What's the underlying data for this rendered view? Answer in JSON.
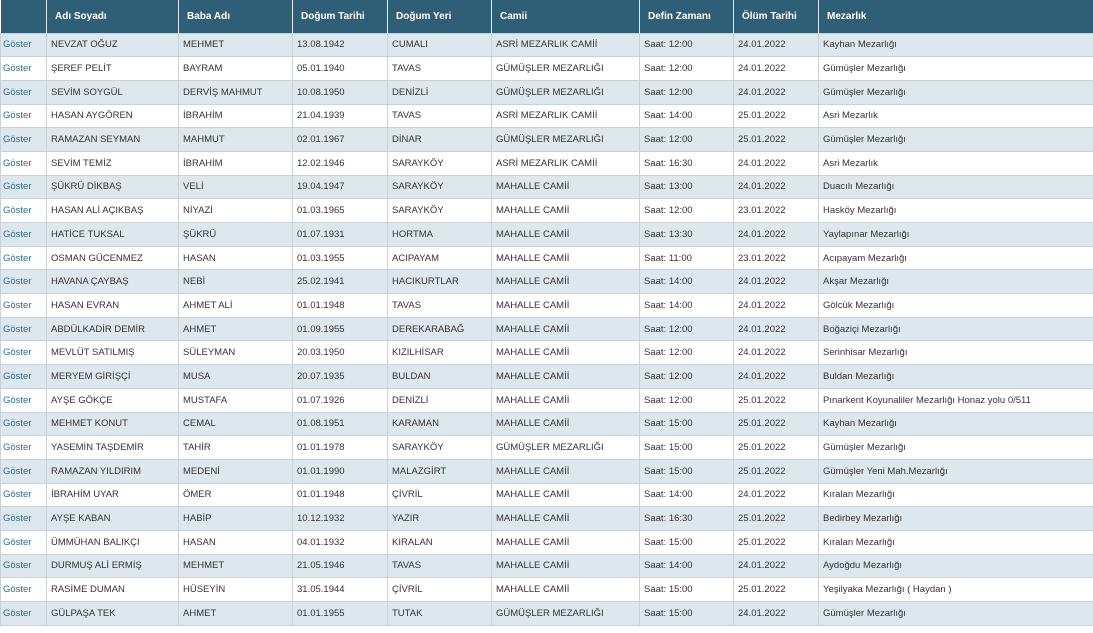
{
  "table": {
    "headers": [
      "",
      "Adı Soyadı",
      "Baba Adı",
      "Doğum Tarihi",
      "Doğum Yeri",
      "Camii",
      "Defin Zamanı",
      "Ölüm Tarihi",
      "Mezarlık"
    ],
    "action_label": "Göster",
    "rows": [
      [
        "NEVZAT OĞUZ",
        "MEHMET",
        "13.08.1942",
        "CUMALI",
        "ASRİ MEZARLIK CAMİİ",
        "Saat: 12:00",
        "24.01.2022",
        "Kayhan Mezarlığı"
      ],
      [
        "ŞEREF PELİT",
        "BAYRAM",
        "05.01.1940",
        "TAVAS",
        "GÜMÜŞLER MEZARLIĞI",
        "Saat: 12:00",
        "24.01.2022",
        "Gümüşler Mezarlığı"
      ],
      [
        "SEVİM SOYGÜL",
        "DERVİŞ MAHMUT",
        "10.08.1950",
        "DENİZLİ",
        "GÜMÜŞLER MEZARLIĞI",
        "Saat: 12:00",
        "24.01.2022",
        "Gümüşler Mezarlığı"
      ],
      [
        "HASAN AYGÖREN",
        "İBRAHİM",
        "21.04.1939",
        "TAVAS",
        "ASRİ MEZARLIK CAMİİ",
        "Saat: 14:00",
        "25.01.2022",
        "Asri Mezarlık"
      ],
      [
        "RAMAZAN SEYMAN",
        "MAHMUT",
        "02.01.1967",
        "DİNAR",
        "GÜMÜŞLER MEZARLIĞI",
        "Saat: 12:00",
        "25.01.2022",
        "Gümüşler Mezarlığı"
      ],
      [
        "SEVİM TEMİZ",
        "İBRAHİM",
        "12.02.1946",
        "SARAYKÖY",
        "ASRİ MEZARLIK CAMİİ",
        "Saat: 16:30",
        "24.01.2022",
        "Asri Mezarlık"
      ],
      [
        "ŞÜKRÜ DİKBAŞ",
        "VELİ",
        "19.04.1947",
        "SARAYKÖY",
        "MAHALLE CAMİİ",
        "Saat: 13:00",
        "24.01.2022",
        "Duacılı Mezarlığı"
      ],
      [
        "HASAN ALİ AÇIKBAŞ",
        "NİYAZİ",
        "01.03.1965",
        "SARAYKÖY",
        "MAHALLE CAMİİ",
        "Saat: 12:00",
        "23.01.2022",
        "Hasköy Mezarlığı"
      ],
      [
        "HATİCE TUKSAL",
        "ŞÜKRÜ",
        "01.07.1931",
        "HORTMA",
        "MAHALLE CAMİİ",
        "Saat: 13:30",
        "24.01.2022",
        "Yaylapınar Mezarlığı"
      ],
      [
        "OSMAN GÜCENMEZ",
        "HASAN",
        "01.03.1955",
        "ACIPAYAM",
        "MAHALLE CAMİİ",
        "Saat: 11:00",
        "23.01.2022",
        "Acıpayam Mezarlığı"
      ],
      [
        "HAVANA ÇAYBAŞ",
        "NEBİ",
        "25.02.1941",
        "HACIKURTLAR",
        "MAHALLE CAMİİ",
        "Saat: 14:00",
        "24.01.2022",
        "Akşar Mezarlığı"
      ],
      [
        "HASAN EVRAN",
        "AHMET ALİ",
        "01.01.1948",
        "TAVAS",
        "MAHALLE CAMİİ",
        "Saat: 14:00",
        "24.01.2022",
        "Gölcük Mezarlığı"
      ],
      [
        "ABDÜLKADİR DEMİR",
        "AHMET",
        "01.09.1955",
        "DEREKARABAĞ",
        "MAHALLE CAMİİ",
        "Saat: 12:00",
        "24.01.2022",
        "Boğaziçi Mezarlığı"
      ],
      [
        "MEVLÜT SATILMIŞ",
        "SÜLEYMAN",
        "20.03.1950",
        "KIZILHİSAR",
        "MAHALLE CAMİİ",
        "Saat: 12:00",
        "24.01.2022",
        "Serinhisar Mezarlığı"
      ],
      [
        "MERYEM GİRİŞÇİ",
        "MUSA",
        "20.07.1935",
        "BULDAN",
        "MAHALLE CAMİİ",
        "Saat: 12:00",
        "24.01.2022",
        "Buldan Mezarlığı"
      ],
      [
        "AYŞE GÖKÇE",
        "MUSTAFA",
        "01.07.1926",
        "DENİZLİ",
        "MAHALLE CAMİİ",
        "Saat: 12:00",
        "25.01.2022",
        "Pınarkent Koyunaliler Mezarlığı Honaz yolu 0/511"
      ],
      [
        "MEHMET KONUT",
        "CEMAL",
        "01.08.1951",
        "KARAMAN",
        "MAHALLE CAMİİ",
        "Saat: 15:00",
        "25.01.2022",
        "Kayhan Mezarlığı"
      ],
      [
        "YASEMİN TAŞDEMİR",
        "TAHİR",
        "01.01.1978",
        "SARAYKÖY",
        "GÜMÜŞLER MEZARLIĞI",
        "Saat: 15:00",
        "25.01.2022",
        "Gümüşler Mezarlığı"
      ],
      [
        "RAMAZAN YILDIRIM",
        "MEDENİ",
        "01.01.1990",
        "MALAZGİRT",
        "MAHALLE CAMİİ",
        "Saat: 15:00",
        "25.01.2022",
        "Gümüşler Yeni Mah.Mezarlığı"
      ],
      [
        "İBRAHİM UYAR",
        "ÖMER",
        "01.01.1948",
        "ÇİVRİL",
        "MAHALLE CAMİİ",
        "Saat: 14:00",
        "24.01.2022",
        "Kıralan Mezarlığı"
      ],
      [
        "AYŞE KABAN",
        "HABİP",
        "10.12.1932",
        "YAZIR",
        "MAHALLE CAMİİ",
        "Saat: 16:30",
        "25.01.2022",
        "Bedirbey Mezarlığı"
      ],
      [
        "ÜMMÜHAN BALIKÇI",
        "HASAN",
        "04.01.1932",
        "KIRALAN",
        "MAHALLE CAMİİ",
        "Saat: 15:00",
        "25.01.2022",
        "Kıralan Mezarlığı"
      ],
      [
        "DURMUŞ ALİ ERMİŞ",
        "MEHMET",
        "21.05.1946",
        "TAVAS",
        "MAHALLE CAMİİ",
        "Saat: 14:00",
        "24.01.2022",
        "Aydoğdu Mezarlığı"
      ],
      [
        "RASİME DUMAN",
        "HÜSEYİN",
        "31.05.1944",
        "ÇİVRİL",
        "MAHALLE CAMİİ",
        "Saat: 15:00",
        "25.01.2022",
        "Yeşilyaka Mezarlığı ( Haydan )"
      ],
      [
        "GÜLPAŞA TEK",
        "AHMET",
        "01.01.1955",
        "TUTAK",
        "GÜMÜŞLER MEZARLIĞI",
        "Saat: 15:00",
        "24.01.2022",
        "Gümüşler Mezarlığı"
      ]
    ]
  },
  "colors": {
    "header_bg": "#2f5f77",
    "row_alt_bg": "#dde8ee",
    "link_color": "#2d6d8c"
  }
}
